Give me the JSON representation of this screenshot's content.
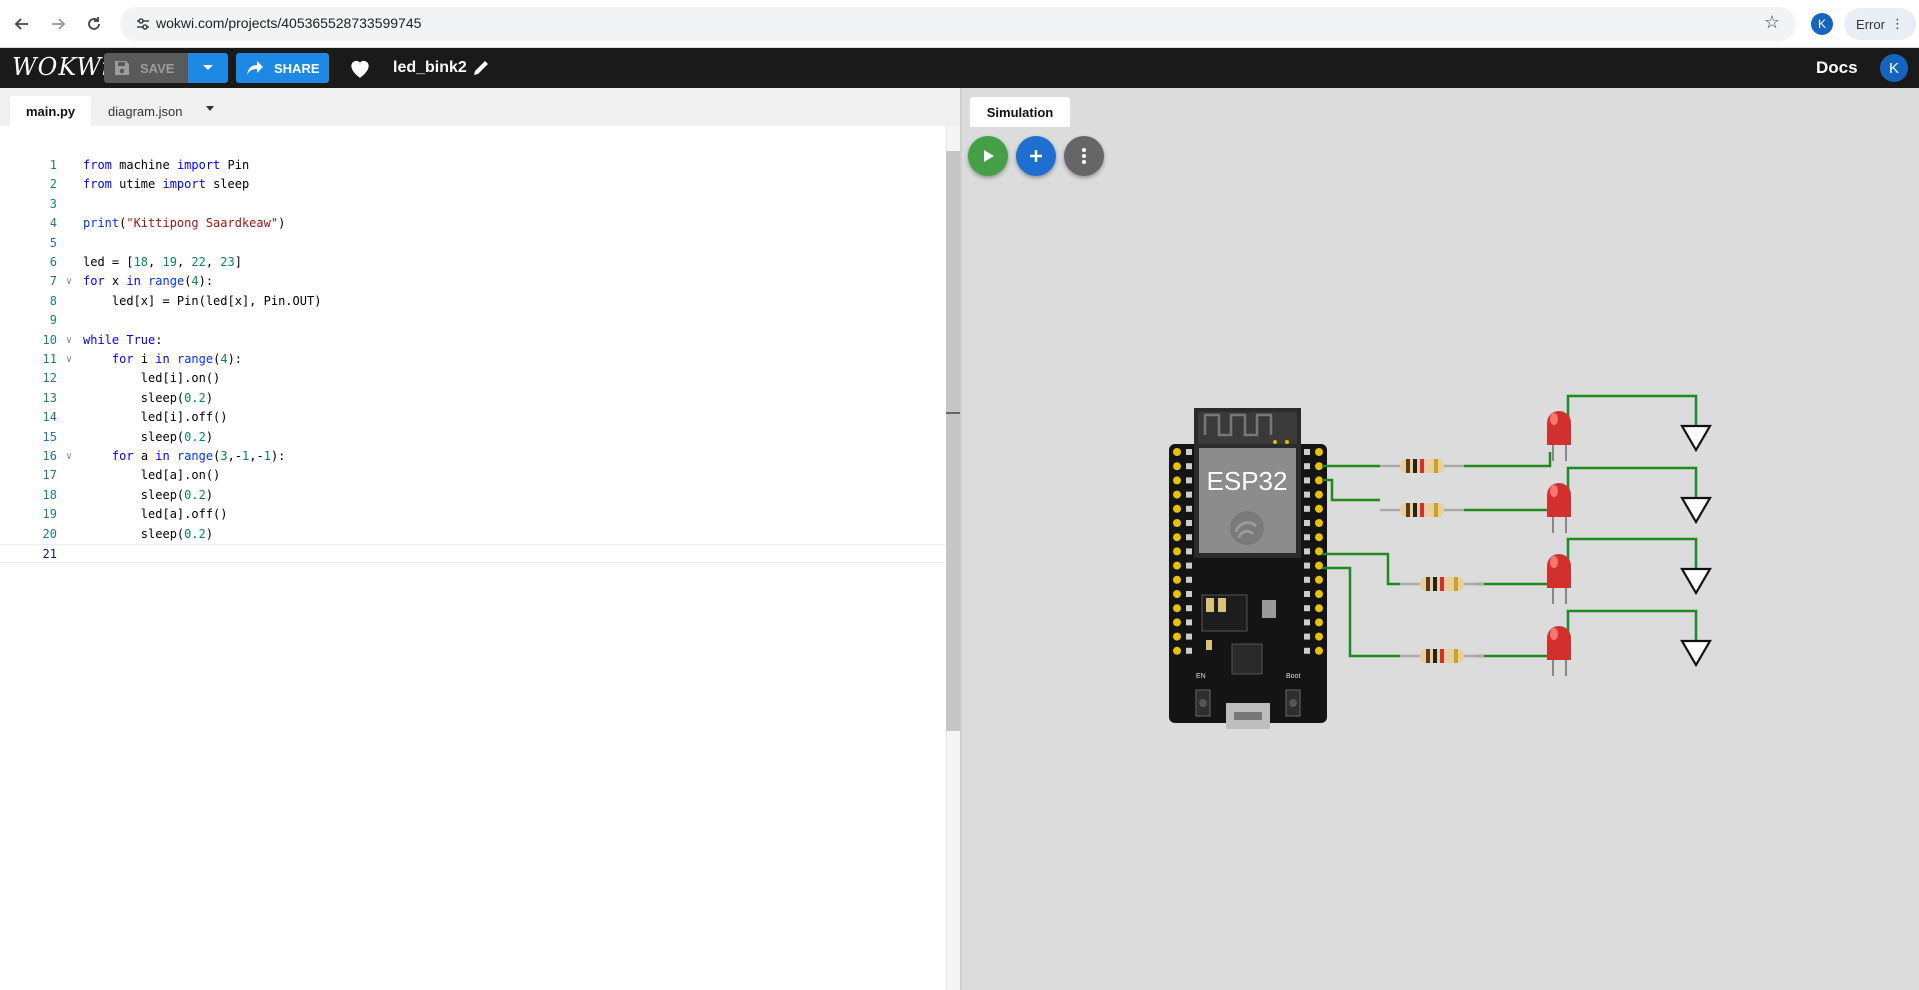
{
  "browser": {
    "url": "wokwi.com/projects/405365528733599745",
    "profile_initial": "K",
    "error_label": "Error"
  },
  "header": {
    "logo": "WOKWi",
    "save_label": "SAVE",
    "share_label": "SHARE",
    "project_name": "led_bink2",
    "docs_label": "Docs",
    "user_initial": "K"
  },
  "editor": {
    "tabs": [
      {
        "label": "main.py",
        "active": true
      },
      {
        "label": "diagram.json",
        "active": false
      }
    ],
    "lines": [
      "from machine import Pin",
      "from utime import sleep",
      "",
      "print(\"Kittipong Saardkeaw\")",
      "",
      "led = [18, 19, 22, 23]",
      "for x in range(4):",
      "    led[x] = Pin(led[x], Pin.OUT)",
      "",
      "while True:",
      "    for i in range(4):",
      "        led[i].on()",
      "        sleep(0.2)",
      "        led[i].off()",
      "        sleep(0.2)",
      "    for a in range(3,-1,-1):",
      "        led[a].on()",
      "        sleep(0.2)",
      "        led[a].off()",
      "        sleep(0.2)",
      ""
    ],
    "fold_lines": [
      7,
      10,
      11,
      16
    ],
    "current_line": 21
  },
  "simulation": {
    "tab_label": "Simulation",
    "board_label": "ESP32",
    "en_label": "EN",
    "boot_label": "Boot",
    "play_color": "#43a047",
    "add_color": "#1e6fd0",
    "more_color": "#666666",
    "wire_color": "#1f8a1f",
    "led_color": "#d32f2f",
    "led_count": 4
  }
}
